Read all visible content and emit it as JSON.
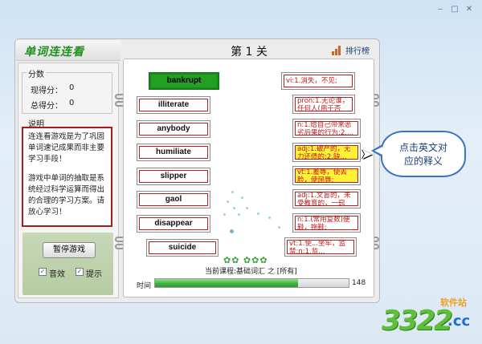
{
  "window": {
    "controls": [
      "‒",
      "□",
      "✕"
    ]
  },
  "app_title": "单词连连看",
  "level_title": "第 1 关",
  "rank_label": "排行榜",
  "score": {
    "group_title": "分数",
    "current_label": "现得分：",
    "current_value": "0",
    "total_label": "总得分：",
    "total_value": "0"
  },
  "description": {
    "group_title": "说明",
    "para1": "连连看游戏是为了巩固单词速记成果而非主要学习手段！",
    "para2": "游戏中单词的抽取是系统经过科学运算而得出的合理的学习方案。请放心学习！"
  },
  "controls": {
    "pause_label": "暂停游戏",
    "sound_label": "音效",
    "hint_label": "提示",
    "sound_checked": true,
    "hint_checked": true
  },
  "words": [
    "bankrupt",
    "illiterate",
    "anybody",
    "humiliate",
    "slipper",
    "gaol",
    "disappear",
    "suicide"
  ],
  "definitions": [
    "vi:1.消失，不见;",
    "pron:1.无论谁，任何人(用于否定...",
    "n:1.给自己带来恶劣后果的行为;2....",
    "adj:1.破产的，无力还债的;2.缺...",
    "vt:1.羞辱，使丢脸，使屈辱;",
    "adj:1.文盲的，未受教育的，一窍不...",
    "n:1.(常用复数)便鞋，拖鞋;",
    "vt:1.使...坐牢，监禁;n:1.监..."
  ],
  "course_text": "当前课程:基础词汇 之 [所有]",
  "time_label": "时间",
  "time_value": "148",
  "time_progress": 0.74,
  "bubble_text_line1": "点击英文对",
  "bubble_text_line2": "应的释义",
  "watermark": {
    "number": "3322",
    "cc": ".cc",
    "site": "软件站"
  },
  "colors": {
    "active_word": "#23a023",
    "highlight_def": "#fff13a",
    "card_border": "#b61e1e",
    "definition_text": "#c41616"
  }
}
